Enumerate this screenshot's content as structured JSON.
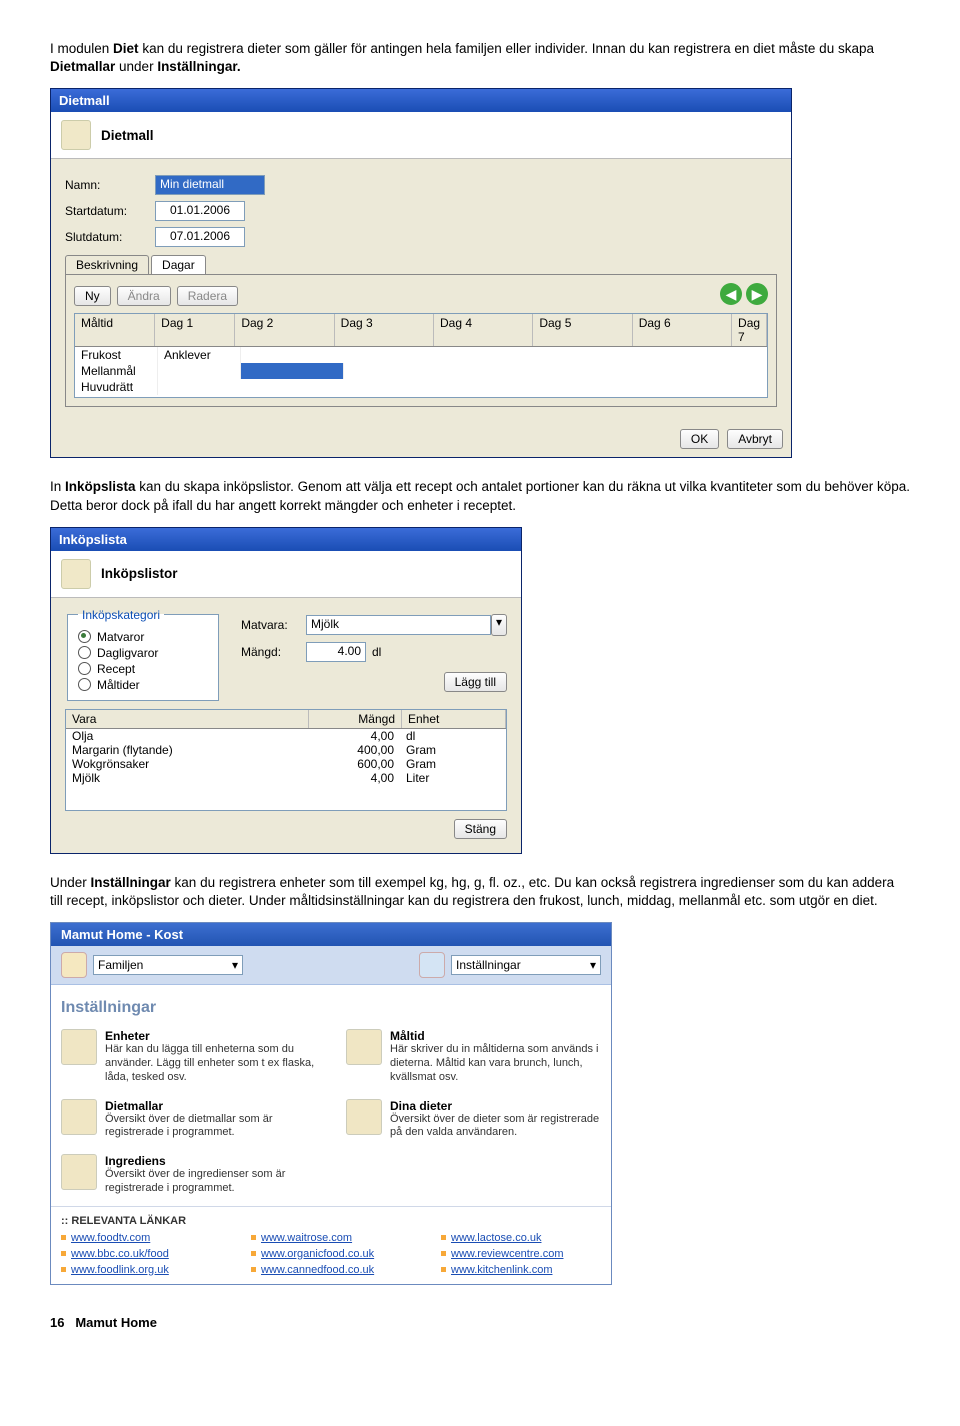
{
  "para1": {
    "pre": "I modulen ",
    "b1": "Diet",
    "mid": " kan du registrera dieter som gäller för antingen hela familjen eller individer. Innan du kan registrera en diet måste du skapa ",
    "b2": "Dietmallar",
    "post": " under ",
    "b3": "Inställningar."
  },
  "dietmall": {
    "title": "Dietmall",
    "header": "Dietmall",
    "labels": {
      "namn": "Namn:",
      "start": "Startdatum:",
      "slut": "Slutdatum:"
    },
    "vals": {
      "namn": "Min dietmall",
      "start": "01.01.2006",
      "slut": "07.01.2006"
    },
    "tabs": [
      "Beskrivning",
      "Dagar"
    ],
    "btns": {
      "ny": "Ny",
      "andra": "Ändra",
      "radera": "Radera"
    },
    "cols": [
      "Måltid",
      "Dag 1",
      "Dag 2",
      "Dag 3",
      "Dag 4",
      "Dag 5",
      "Dag 6",
      "Dag 7"
    ],
    "mealrows": [
      "Frukost",
      "Mellanmål",
      "Huvudrätt"
    ],
    "dag1": "Anklever",
    "ok": "OK",
    "avbryt": "Avbryt"
  },
  "para2": {
    "pre": "In ",
    "b1": "Inköpslista",
    "post": " kan du skapa inköpslistor. Genom att välja ett recept och antalet portioner kan du räkna ut vilka kvantiteter som du behöver köpa. Detta beror dock på ifall du har angett korrekt mängder och enheter i receptet."
  },
  "inkop": {
    "title": "Inköpslista",
    "header": "Inköpslistor",
    "group": "Inköpskategori",
    "radios": [
      "Matvaror",
      "Dagligvaror",
      "Recept",
      "Måltider"
    ],
    "lbls": {
      "matvara": "Matvara:",
      "mangd": "Mängd:"
    },
    "vals": {
      "matvara": "Mjölk",
      "mangd": "4.00",
      "enhet": "dl"
    },
    "add": "Lägg till",
    "cols": [
      "Vara",
      "Mängd",
      "Enhet"
    ],
    "rows": [
      {
        "v": "Olja",
        "m": "4,00",
        "e": "dl"
      },
      {
        "v": "Margarin (flytande)",
        "m": "400,00",
        "e": "Gram"
      },
      {
        "v": "Wokgrönsaker",
        "m": "600,00",
        "e": "Gram"
      },
      {
        "v": "Mjölk",
        "m": "4,00",
        "e": "Liter"
      }
    ],
    "stang": "Stäng"
  },
  "para3": {
    "pre": "Under ",
    "b1": "Inställningar",
    "post": " kan du registrera enheter som till exempel kg, hg, g, fl. oz., etc. Du kan också registrera ingredienser som du kan addera till recept, inköpslistor och dieter. Under måltidsinställningar kan du registrera den frukost, lunch, middag, mellanmål etc. som utgör en diet."
  },
  "panel": {
    "title": "Mamut Home - Kost",
    "nav": {
      "familjen": "Familjen",
      "installningar": "Inställningar"
    },
    "heading": "Inställningar",
    "cards": [
      {
        "t": "Enheter",
        "d": "Här kan du lägga till enheterna som du använder. Lägg till enheter som t ex flaska, låda, tesked osv."
      },
      {
        "t": "Måltid",
        "d": "Här skriver du in måltiderna som används i dieterna. Måltid kan vara brunch, lunch, kvällsmat osv."
      },
      {
        "t": "Dietmallar",
        "d": "Översikt över de dietmallar som är registrerade i programmet."
      },
      {
        "t": "Dina dieter",
        "d": "Översikt över de dieter som är registrerade på den valda användaren."
      },
      {
        "t": "Ingrediens",
        "d": "Översikt över de ingredienser som är registrerade i programmet."
      }
    ],
    "links_title": ":: RELEVANTA LÄNKAR",
    "links": [
      "www.foodtv.com",
      "www.waitrose.com",
      "www.lactose.co.uk",
      "www.bbc.co.uk/food",
      "www.organicfood.co.uk",
      "www.reviewcentre.com",
      "www.foodlink.org.uk",
      "www.cannedfood.co.uk",
      "www.kitchenlink.com"
    ]
  },
  "footer": {
    "page": "16",
    "title": "Mamut Home"
  }
}
